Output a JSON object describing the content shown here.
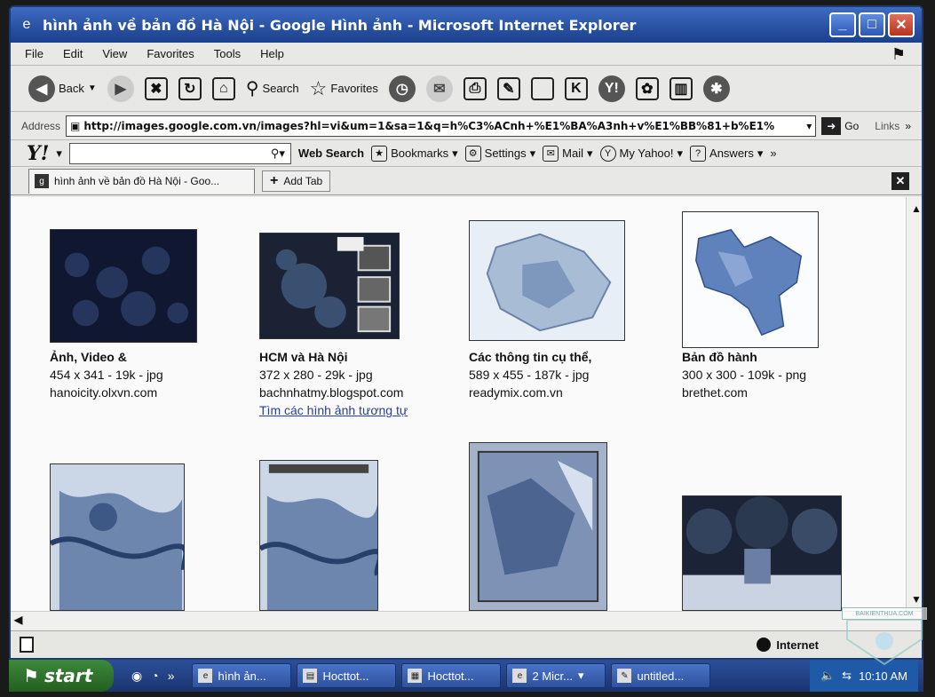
{
  "window": {
    "title": "hình ảnh về bản đồ Hà Nội - Google Hình ảnh - Microsoft Internet Explorer"
  },
  "menu": [
    "File",
    "Edit",
    "View",
    "Favorites",
    "Tools",
    "Help"
  ],
  "toolbar": {
    "back_label": "Back",
    "search_label": "Search",
    "favorites_label": "Favorites"
  },
  "address": {
    "label": "Address",
    "url": "http://images.google.com.vn/images?hl=vi&um=1&sa=1&q=h%C3%ACnh+%E1%BA%A3nh+v%E1%BB%81+b%E1%",
    "go_label": "Go",
    "links_label": "Links"
  },
  "yahoo": {
    "web_search_label": "Web Search",
    "bookmarks_label": "Bookmarks",
    "settings_label": "Settings",
    "mail_label": "Mail",
    "my_yahoo_label": "My Yahoo!",
    "answers_label": "Answers"
  },
  "tabs": {
    "active_tab": "hình ảnh về bản đồ Hà Nội - Goo...",
    "add_tab_label": "Add Tab"
  },
  "results": [
    {
      "title": "Ảnh, Video &",
      "meta": "454 x 341 - 19k - jpg",
      "site": "hanoicity.olxvn.com",
      "similar": ""
    },
    {
      "title": "HCM và Hà Nội",
      "meta": "372 x 280 - 29k - jpg",
      "site": "bachnhatmy.blogspot.com",
      "similar": "Tìm các hình ảnh tương tự"
    },
    {
      "title": "Các thông tin cụ thể,",
      "meta": "589 x 455 - 187k - jpg",
      "site": "readymix.com.vn",
      "similar": ""
    },
    {
      "title": "Bản đồ hành",
      "meta": "300 x 300 - 109k - png",
      "site": "brethet.com",
      "similar": ""
    }
  ],
  "status": {
    "zone": "Internet"
  },
  "taskbar": {
    "start_label": "start",
    "tasks": [
      "hình ản...",
      "Hocttot...",
      "Hocttot...",
      "2 Micr...",
      "untitled..."
    ],
    "clock": "10:10 AM"
  },
  "watermark": {
    "text": "BAIKIENTHUA.COM"
  }
}
